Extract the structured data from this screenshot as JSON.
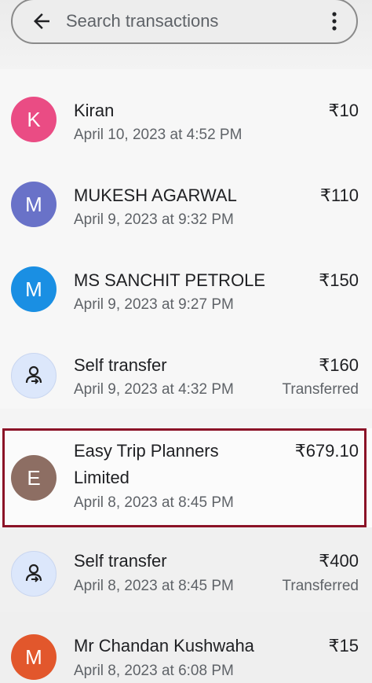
{
  "search": {
    "placeholder": "Search transactions"
  },
  "transactions": [
    {
      "avatar_letter": "K",
      "avatar_color": "#ea4c84",
      "name": "Kiran",
      "date": "April 10, 2023 at 4:52 PM",
      "amount": "₹10",
      "status": ""
    },
    {
      "avatar_letter": "M",
      "avatar_color": "#6972c8",
      "name": "MUKESH AGARWAL",
      "date": "April 9, 2023 at 9:32 PM",
      "amount": "₹110",
      "status": ""
    },
    {
      "avatar_letter": "M",
      "avatar_color": "#1a8fe3",
      "name": "MS SANCHIT PETROLE",
      "date": "April 9, 2023 at 9:27 PM",
      "amount": "₹150",
      "status": ""
    },
    {
      "avatar_icon": "self-transfer-icon",
      "avatar_color": "#dce7fb",
      "name": "Self transfer",
      "date": "April 9, 2023 at 4:32 PM",
      "amount": "₹160",
      "status": "Transferred"
    },
    {
      "avatar_letter": "E",
      "avatar_color": "#8d6e63",
      "name_line1": "Easy Trip Planners",
      "name_line2": "Limited",
      "date": "April 8, 2023 at 8:45 PM",
      "amount": "₹679.10",
      "status": ""
    },
    {
      "avatar_icon": "self-transfer-icon",
      "avatar_color": "#dce7fb",
      "name": "Self transfer",
      "date": "April 8, 2023 at 8:45 PM",
      "amount": "₹400",
      "status": "Transferred"
    },
    {
      "avatar_letter": "M",
      "avatar_color": "#e2572c",
      "name": "Mr Chandan Kushwaha",
      "date": "April 8, 2023 at 6:08 PM",
      "amount": "₹15",
      "status": ""
    }
  ]
}
